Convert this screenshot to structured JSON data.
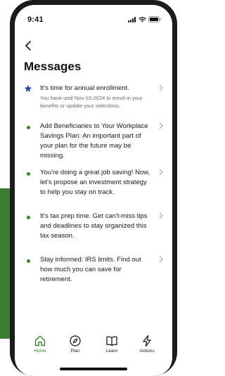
{
  "status_bar": {
    "time": "9:41",
    "icons": [
      "signal-icon",
      "wifi-icon",
      "battery-icon"
    ]
  },
  "header": {
    "back_icon": "chevron-left-icon",
    "title": "Messages"
  },
  "messages": [
    {
      "bullet": "star-icon",
      "title": "It's time for annual enrollment.",
      "subtitle": "You have until Nov-15-2024 to enroll in your benefits or update your selections."
    },
    {
      "bullet": "dot",
      "title": "Add Beneficiaries to Your Workplace Savings Plan: An important part of your plan for the future may be missing."
    },
    {
      "bullet": "dot",
      "title": "You're doing a great job saving! Now, let's propose an investment strategy to help you stay on track."
    },
    {
      "bullet": "dot",
      "title": "It's tax prep time. Get can't-miss tips and deadlines to stay organized this tax season."
    },
    {
      "bullet": "dot",
      "title": "Stay informed: IRS limits. Find out how much you can save for retirement."
    }
  ],
  "tab_bar": {
    "tabs": [
      {
        "label": "Home",
        "icon": "home-icon",
        "active": true
      },
      {
        "label": "Plan",
        "icon": "compass-icon",
        "active": false
      },
      {
        "label": "Learn",
        "icon": "book-icon",
        "active": false
      },
      {
        "label": "Actions",
        "icon": "lightning-icon",
        "active": false
      }
    ]
  },
  "colors": {
    "accent_green": "#368727",
    "star_blue": "#2a4aa8",
    "background_green": "#3e7d31",
    "phone_frame": "#1b1b1b"
  }
}
